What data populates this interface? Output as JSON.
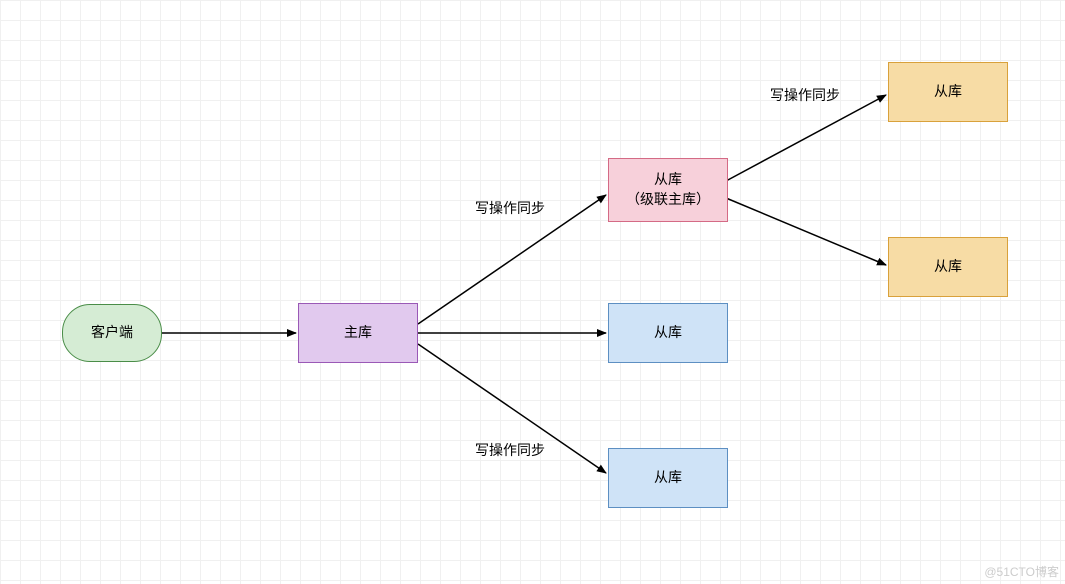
{
  "nodes": {
    "client": "客户端",
    "master": "主库",
    "slave_cascade": "从库\n（级联主库）",
    "slave_mid": "从库",
    "slave_bottom": "从库",
    "slave_top_right": "从库",
    "slave_bottom_right": "从库"
  },
  "labels": {
    "sync_top": "写操作同步",
    "sync_bottom": "写操作同步",
    "sync_right": "写操作同步"
  },
  "watermark": "@51CTO博客"
}
